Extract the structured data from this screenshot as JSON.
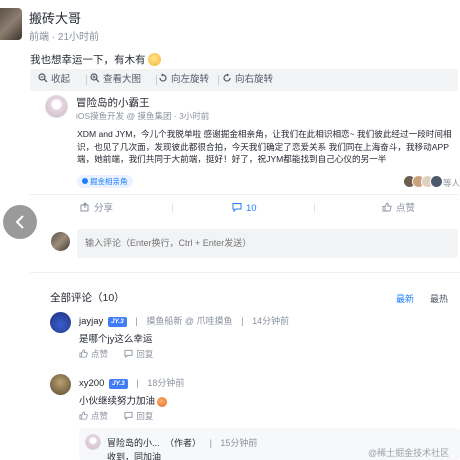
{
  "post": {
    "author": "搬砖大哥",
    "meta": "前端 · 21小时前",
    "text": "我也想幸运一下，有木有"
  },
  "image_toolbar": {
    "collapse": "收起",
    "view_large": "查看大图",
    "rotate_left": "向左旋转",
    "rotate_right": "向右旋转"
  },
  "quoted": {
    "author": "冒险岛的小霸王",
    "meta": "iOS摸鱼开发 @ 摸鱼集团 · 3小时前",
    "body": "XDM and JYM，今儿个我脱单啦 感谢掘金相亲角，让我们在此相识相恋~ 我们彼此经过一段时间相识，也见了几次面，发现彼此都很合拍，今天我们确定了恋爱关系 我们同在上海奋斗，我移动APP端，她前端，我们共同于大前端，挺好！好了，祝JYM都能找到自己心仪的另一半",
    "topic": "掘金相亲角",
    "likers_text": "等人赞过"
  },
  "actions": {
    "share": "分享",
    "comments": "10",
    "likes": "点赞"
  },
  "comment_input": {
    "placeholder": "输入评论（Enter换行，Ctrl + Enter发送）"
  },
  "comments_section": {
    "title": "全部评论（10）",
    "sort_latest": "最新",
    "sort_hot": "最热"
  },
  "comments": [
    {
      "user": "jayjay",
      "badge": "JY.3",
      "title": "摸鱼船新 @ 爪哇摸鱼",
      "time": "14分钟前",
      "text": "是哪个jy这么幸运",
      "like": "点赞",
      "reply": "回复"
    },
    {
      "user": "xy200",
      "badge": "JY.3",
      "time": "18分钟前",
      "text": "小伙继续努力加油",
      "like": "点赞",
      "reply": "回复"
    }
  ],
  "reply": {
    "user": "冒险岛的小...",
    "role": "（作者）",
    "time": "15分钟前",
    "text": "收到，同加油"
  },
  "watermark": "@稀土掘金技术社区",
  "colors": {
    "accent": "#1e80ff",
    "text_primary": "#252933",
    "text_secondary": "#8a919f",
    "toolbar_bg": "#f2f3f5"
  }
}
